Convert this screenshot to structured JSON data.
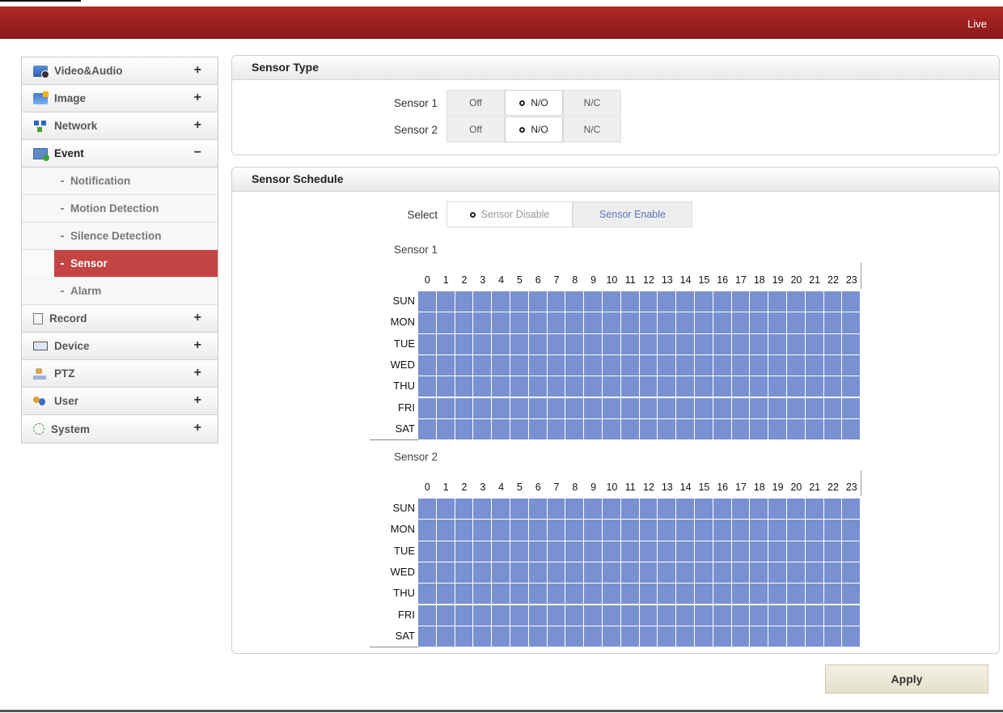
{
  "header": {
    "live_label": "Live"
  },
  "sidebar": {
    "menus": [
      {
        "label": "Video&Audio",
        "icon": "video-audio-icon",
        "sign": "+"
      },
      {
        "label": "Image",
        "icon": "image-icon",
        "sign": "+"
      },
      {
        "label": "Network",
        "icon": "network-icon",
        "sign": "+"
      },
      {
        "label": "Event",
        "icon": "event-icon",
        "sign": "−",
        "open": true
      },
      {
        "label": "Record",
        "icon": "record-icon",
        "sign": "+"
      },
      {
        "label": "Device",
        "icon": "device-icon",
        "sign": "+"
      },
      {
        "label": "PTZ",
        "icon": "ptz-icon",
        "sign": "+"
      },
      {
        "label": "User",
        "icon": "user-icon",
        "sign": "+"
      },
      {
        "label": "System",
        "icon": "system-icon",
        "sign": "+"
      }
    ],
    "event_submenu": [
      "Notification",
      "Motion Detection",
      "Silence Detection",
      "Sensor",
      "Alarm"
    ],
    "active_submenu": "Sensor"
  },
  "sensor_type": {
    "title": "Sensor Type",
    "sensors": [
      {
        "label": "Sensor 1",
        "options": [
          "Off",
          "N/O",
          "N/C"
        ],
        "selected": "N/O"
      },
      {
        "label": "Sensor 2",
        "options": [
          "Off",
          "N/O",
          "N/C"
        ],
        "selected": "N/O"
      }
    ]
  },
  "sensor_schedule": {
    "title": "Sensor Schedule",
    "select_label": "Select",
    "select_options": [
      "Sensor Disable",
      "Sensor Enable"
    ],
    "selected": "Sensor Disable",
    "hours": [
      "0",
      "1",
      "2",
      "3",
      "4",
      "5",
      "6",
      "7",
      "8",
      "9",
      "10",
      "11",
      "12",
      "13",
      "14",
      "15",
      "16",
      "17",
      "18",
      "19",
      "20",
      "21",
      "22",
      "23"
    ],
    "days": [
      "SUN",
      "MON",
      "TUE",
      "WED",
      "THU",
      "FRI",
      "SAT"
    ],
    "schedules": [
      {
        "label": "Sensor 1",
        "all_active": true
      },
      {
        "label": "Sensor 2",
        "all_active": true
      }
    ],
    "active_cell_color": "#7990d1"
  },
  "apply_label": "Apply",
  "colors": {
    "header": "#9a1f1f",
    "active_menu": "#c44343"
  }
}
